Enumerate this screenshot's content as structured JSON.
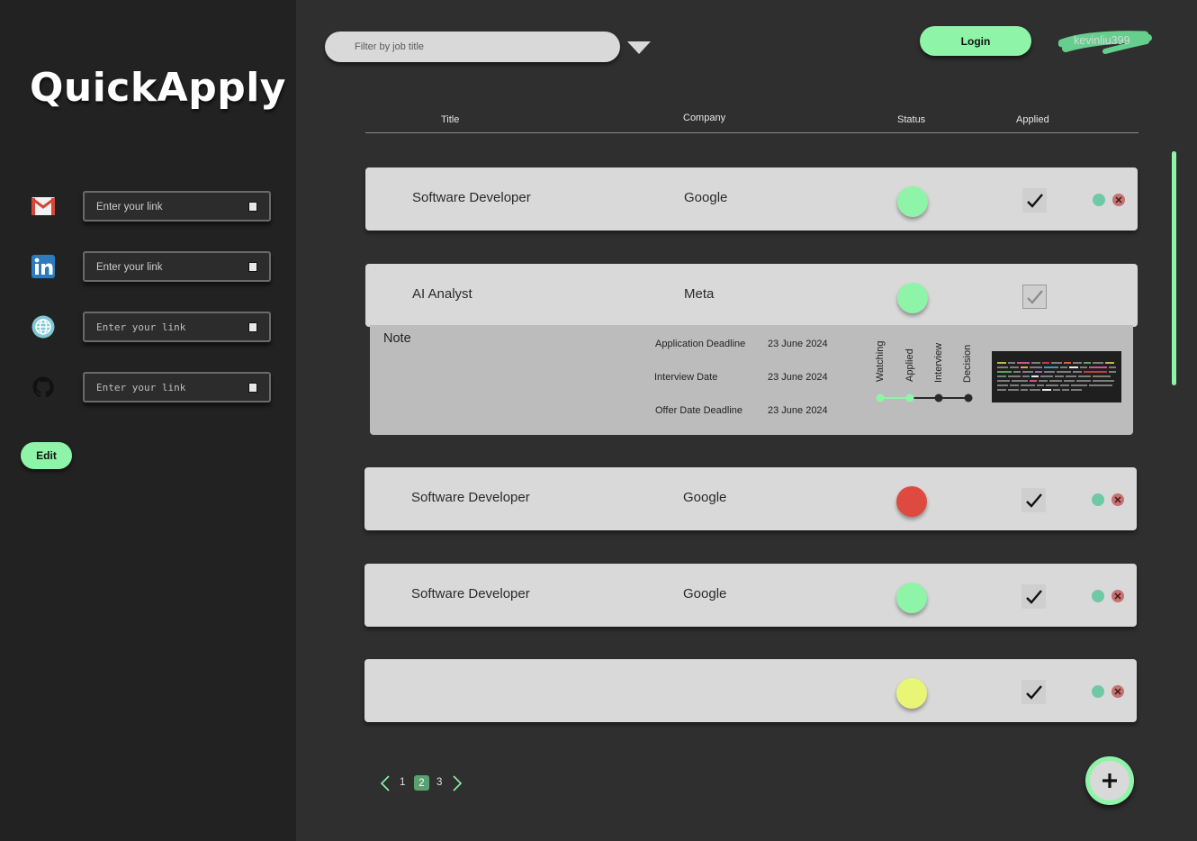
{
  "app": {
    "title": "QuickApply"
  },
  "sidebar": {
    "links": [
      {
        "icon": "gmail-icon",
        "placeholder": "Enter your link"
      },
      {
        "icon": "linkedin-icon",
        "placeholder": "Enter your link"
      },
      {
        "icon": "globe-icon",
        "placeholder": "Enter your link"
      },
      {
        "icon": "github-icon",
        "placeholder": "Enter your link"
      }
    ],
    "edit_label": "Edit"
  },
  "topbar": {
    "filter_placeholder": "Filter by job title",
    "login_label": "Login",
    "username": "kevinliu399"
  },
  "table": {
    "headers": {
      "title": "Title",
      "company": "Company",
      "status": "Status",
      "applied": "Applied"
    },
    "rows": [
      {
        "title": "Software Developer",
        "company": "Google",
        "status_color": "#8ef4a8",
        "applied": true
      },
      {
        "title": "AI Analyst",
        "company": "Meta",
        "status_color": "#8ef4a8",
        "applied": true,
        "expanded": true
      },
      {
        "title": "Software Developer",
        "company": "Google",
        "status_color": "#de4a40",
        "applied": true
      },
      {
        "title": "Software Developer",
        "company": "Google",
        "status_color": "#8ef4a8",
        "applied": true
      },
      {
        "title": "",
        "company": "",
        "status_color": "#e9f574",
        "applied": true
      }
    ]
  },
  "detail": {
    "note_label": "Note",
    "dates": [
      {
        "label": "Application Deadline",
        "value": "23 June 2024"
      },
      {
        "label": "Interview Date",
        "value": "23 June 2024"
      },
      {
        "label": "Offer Date Deadline",
        "value": "23 June 2024"
      }
    ],
    "stages": [
      "Watching",
      "Applied",
      "Interview",
      "Decision"
    ],
    "stages_completed": 2
  },
  "pagination": {
    "pages": [
      "1",
      "2",
      "3"
    ],
    "current": "2"
  },
  "colors": {
    "accent": "#8ef4a8",
    "sidebar_bg": "#222222",
    "main_bg": "#2f2f2f",
    "card_bg": "#d9d9d9"
  }
}
